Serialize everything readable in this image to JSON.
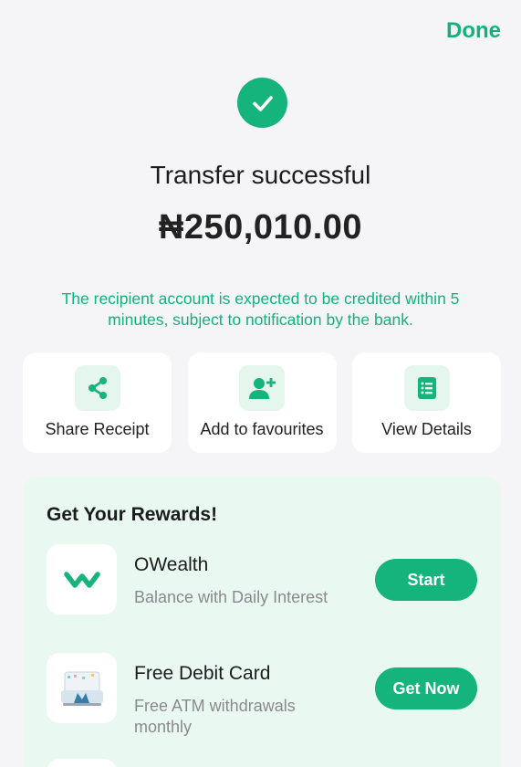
{
  "header": {
    "done_label": "Done"
  },
  "status": {
    "title": "Transfer successful",
    "amount": "₦250,010.00",
    "notice": "The recipient account is expected to be credited within 5 minutes, subject to notification by the bank."
  },
  "actions": [
    {
      "label": "Share Receipt",
      "icon": "share-icon"
    },
    {
      "label": "Add to favourites",
      "icon": "add-user-icon"
    },
    {
      "label": "View Details",
      "icon": "list-icon"
    }
  ],
  "rewards": {
    "title": "Get Your Rewards!",
    "items": [
      {
        "title": "OWealth",
        "subtitle": "Balance with Daily Interest",
        "button": "Start",
        "icon": "owealth-logo"
      },
      {
        "title": "Free Debit Card",
        "subtitle": "Free ATM withdrawals monthly",
        "button": "Get Now",
        "icon": "debit-card-image"
      }
    ]
  },
  "colors": {
    "accent": "#14b47c",
    "accent_text": "#12b27a",
    "reward_bg": "#e9f8f1",
    "icon_bg": "#e4f6ee"
  }
}
